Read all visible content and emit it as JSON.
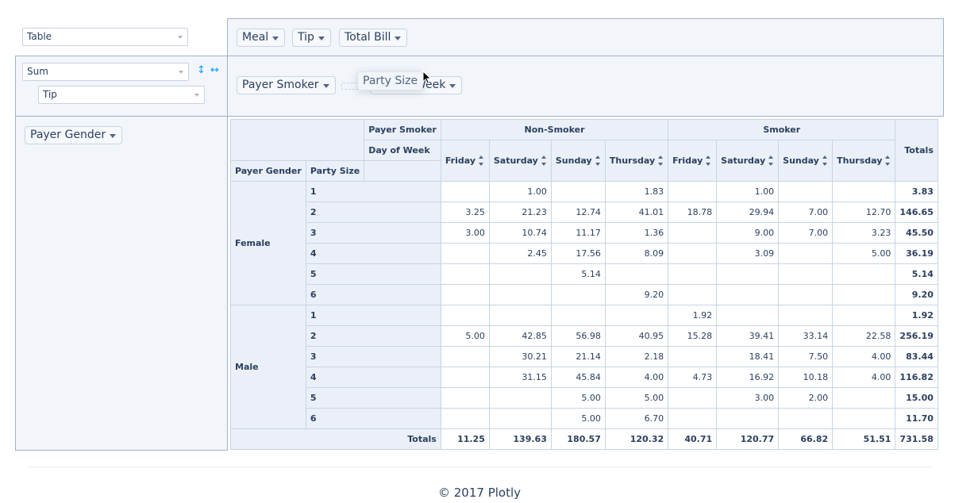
{
  "renderer": {
    "value": "Table"
  },
  "aggregator": {
    "value": "Sum"
  },
  "aggregator_attr": {
    "value": "Tip"
  },
  "unused_attrs": [
    {
      "label": "Meal"
    },
    {
      "label": "Tip"
    },
    {
      "label": "Total Bill"
    }
  ],
  "col_attrs": [
    {
      "label": "Payer Smoker"
    },
    {
      "label": "Day of Week"
    }
  ],
  "dragging_attr": {
    "label": "Party Size"
  },
  "row_attrs": [
    {
      "label": "Payer Gender"
    }
  ],
  "table": {
    "header_labels": {
      "col_attr_1": "Payer Smoker",
      "col_attr_2": "Day of Week",
      "row_attr_1": "Payer Gender",
      "row_attr_2": "Party Size",
      "totals": "Totals"
    },
    "col_groups": [
      "Non-Smoker",
      "Smoker"
    ],
    "days": [
      "Friday",
      "Saturday",
      "Sunday",
      "Thursday",
      "Friday",
      "Saturday",
      "Sunday",
      "Thursday"
    ],
    "genders": [
      "Female",
      "Male"
    ],
    "rows": [
      {
        "size": "1",
        "cells": [
          "",
          "1.00",
          "",
          "1.83",
          "",
          "1.00",
          "",
          ""
        ],
        "total": "3.83"
      },
      {
        "size": "2",
        "cells": [
          "3.25",
          "21.23",
          "12.74",
          "41.01",
          "18.78",
          "29.94",
          "7.00",
          "12.70"
        ],
        "total": "146.65"
      },
      {
        "size": "3",
        "cells": [
          "3.00",
          "10.74",
          "11.17",
          "1.36",
          "",
          "9.00",
          "7.00",
          "3.23"
        ],
        "total": "45.50"
      },
      {
        "size": "4",
        "cells": [
          "",
          "2.45",
          "17.56",
          "8.09",
          "",
          "3.09",
          "",
          "5.00"
        ],
        "total": "36.19"
      },
      {
        "size": "5",
        "cells": [
          "",
          "",
          "5.14",
          "",
          "",
          "",
          "",
          ""
        ],
        "total": "5.14"
      },
      {
        "size": "6",
        "cells": [
          "",
          "",
          "",
          "9.20",
          "",
          "",
          "",
          ""
        ],
        "total": "9.20"
      },
      {
        "size": "1",
        "cells": [
          "",
          "",
          "",
          "",
          "1.92",
          "",
          "",
          ""
        ],
        "total": "1.92"
      },
      {
        "size": "2",
        "cells": [
          "5.00",
          "42.85",
          "56.98",
          "40.95",
          "15.28",
          "39.41",
          "33.14",
          "22.58"
        ],
        "total": "256.19"
      },
      {
        "size": "3",
        "cells": [
          "",
          "30.21",
          "21.14",
          "2.18",
          "",
          "18.41",
          "7.50",
          "4.00"
        ],
        "total": "83.44"
      },
      {
        "size": "4",
        "cells": [
          "",
          "31.15",
          "45.84",
          "4.00",
          "4.73",
          "16.92",
          "10.18",
          "4.00"
        ],
        "total": "116.82"
      },
      {
        "size": "5",
        "cells": [
          "",
          "",
          "5.00",
          "5.00",
          "",
          "3.00",
          "2.00",
          ""
        ],
        "total": "15.00"
      },
      {
        "size": "6",
        "cells": [
          "",
          "",
          "5.00",
          "6.70",
          "",
          "",
          "",
          ""
        ],
        "total": "11.70"
      }
    ],
    "col_totals_label": "Totals",
    "col_totals": [
      "11.25",
      "139.63",
      "180.57",
      "120.32",
      "40.71",
      "120.77",
      "66.82",
      "51.51"
    ],
    "grand_total": "731.58"
  },
  "footer": {
    "text": "© 2017 Plotly"
  }
}
